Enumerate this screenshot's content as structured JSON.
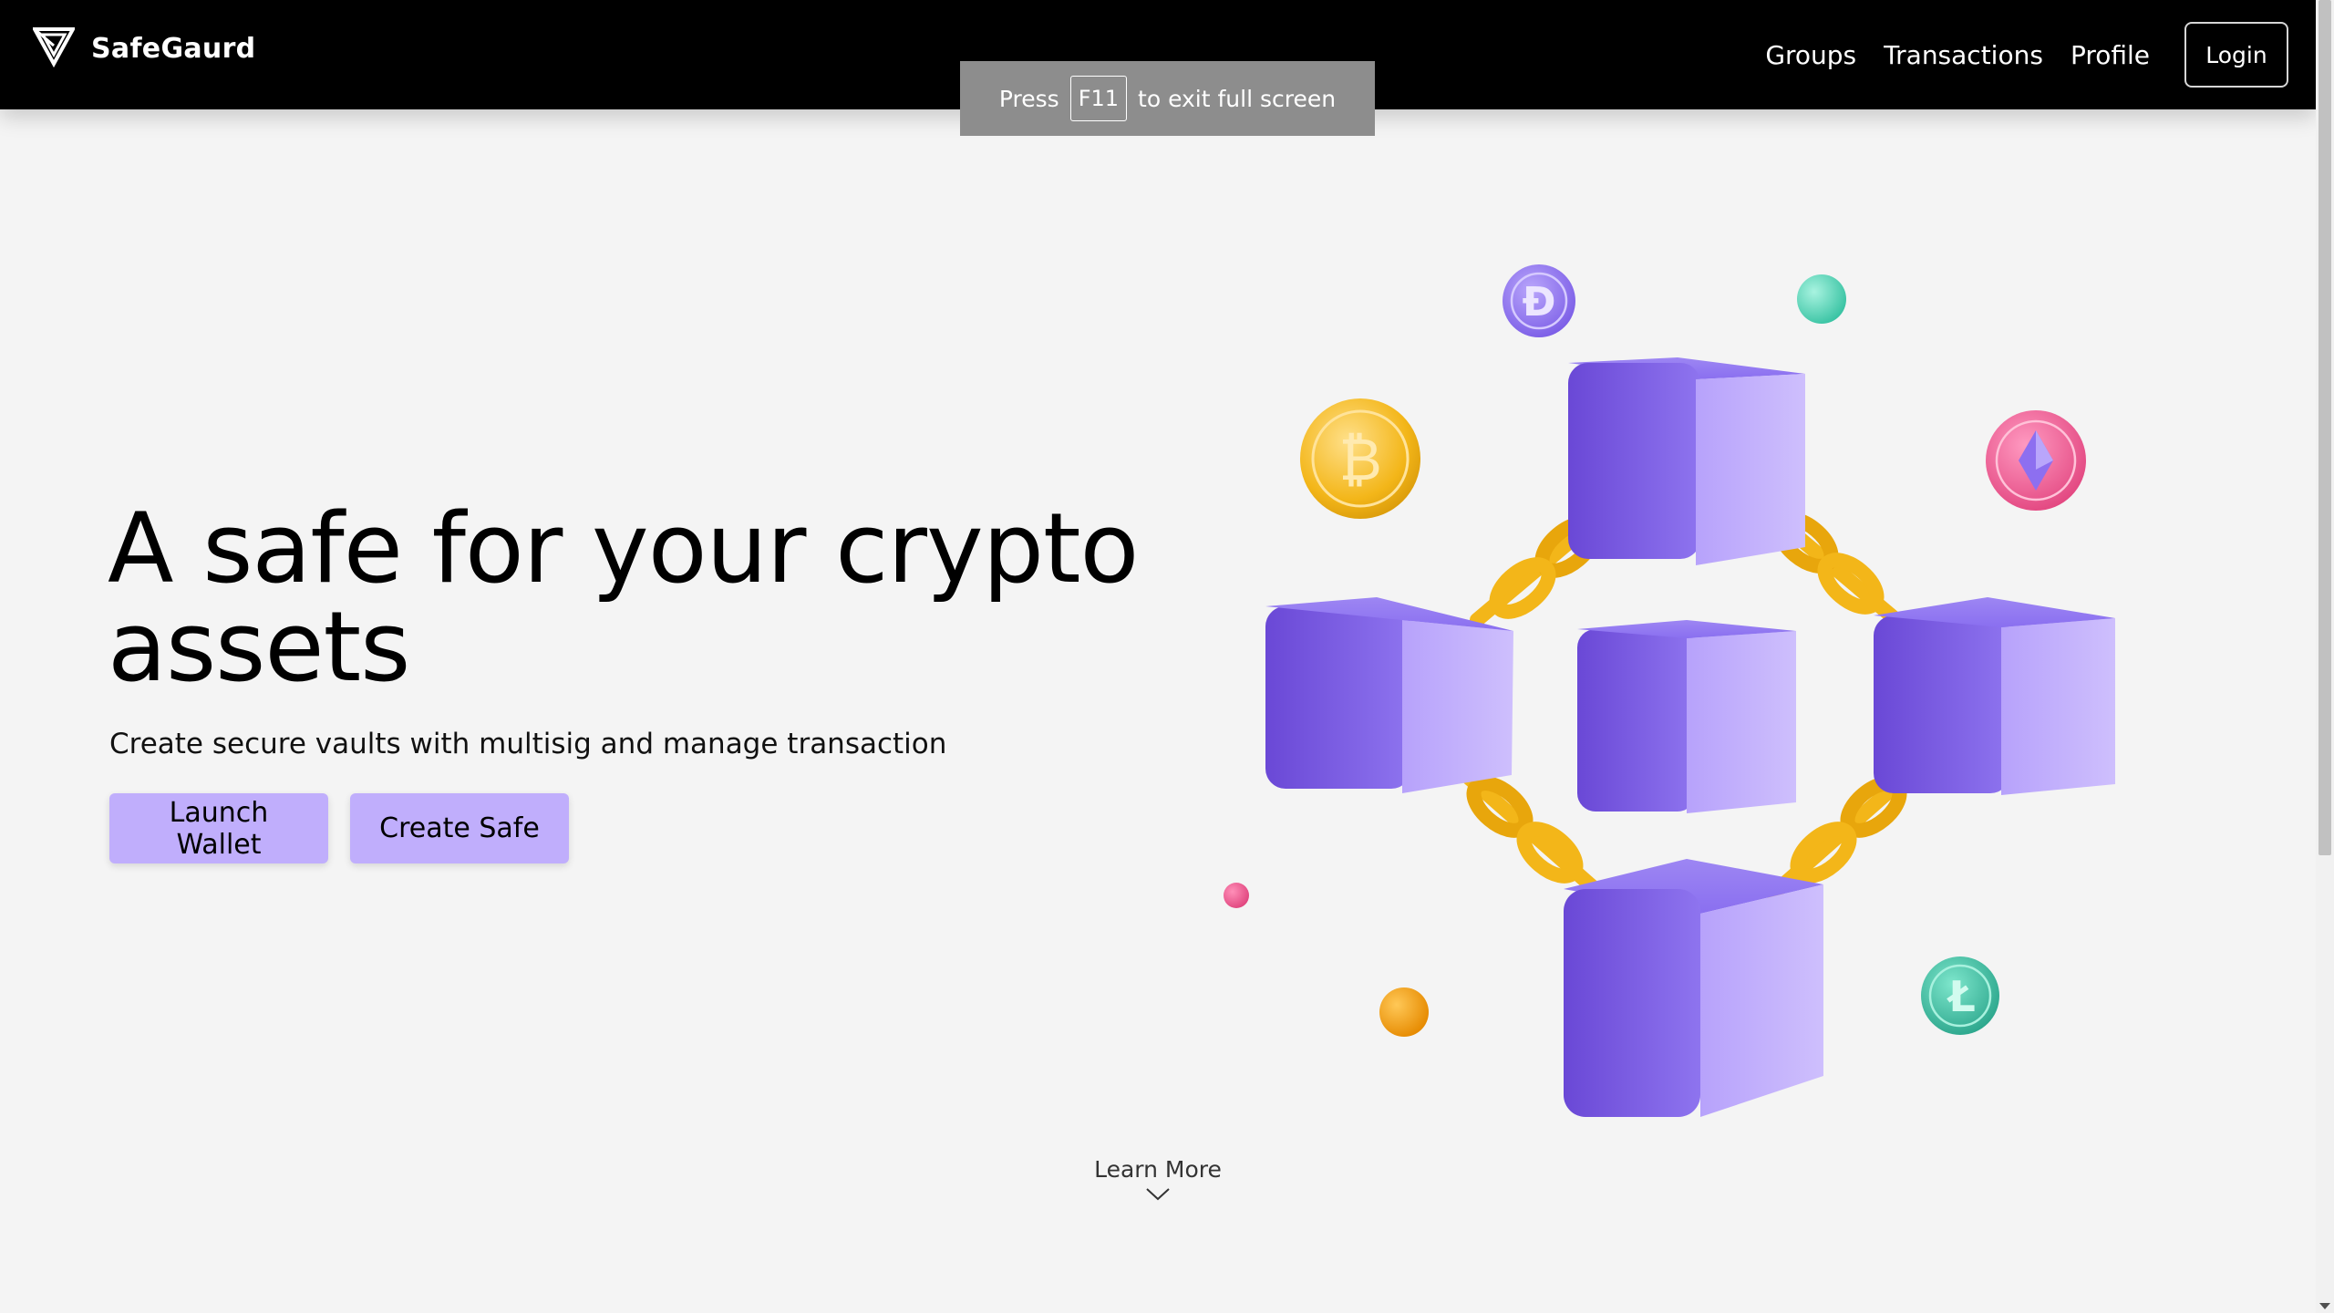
{
  "navbar": {
    "brand": "SafeGaurd",
    "links": [
      "Groups",
      "Transactions",
      "Profile"
    ],
    "login_label": "Login"
  },
  "fullscreen_toast": {
    "press": "Press",
    "key": "F11",
    "rest": "to exit full screen"
  },
  "hero": {
    "title": "A safe for your crypto assets",
    "subtitle": "Create secure vaults with multisig and manage transaction",
    "launch_label": "Launch Wallet",
    "create_label": "Create Safe"
  },
  "learn_more": "Learn More",
  "colors": {
    "navbar_bg": "#000000",
    "page_bg": "#f4f4f4",
    "button_bg": "#c0aefc",
    "cube_purple": "#8a6ff0",
    "chain_gold": "#f3b619"
  },
  "illustration": {
    "coins": [
      "bitcoin-coin",
      "dogecoin-coin",
      "ethereum-coin",
      "litecoin-coin"
    ],
    "cubes": 5
  }
}
